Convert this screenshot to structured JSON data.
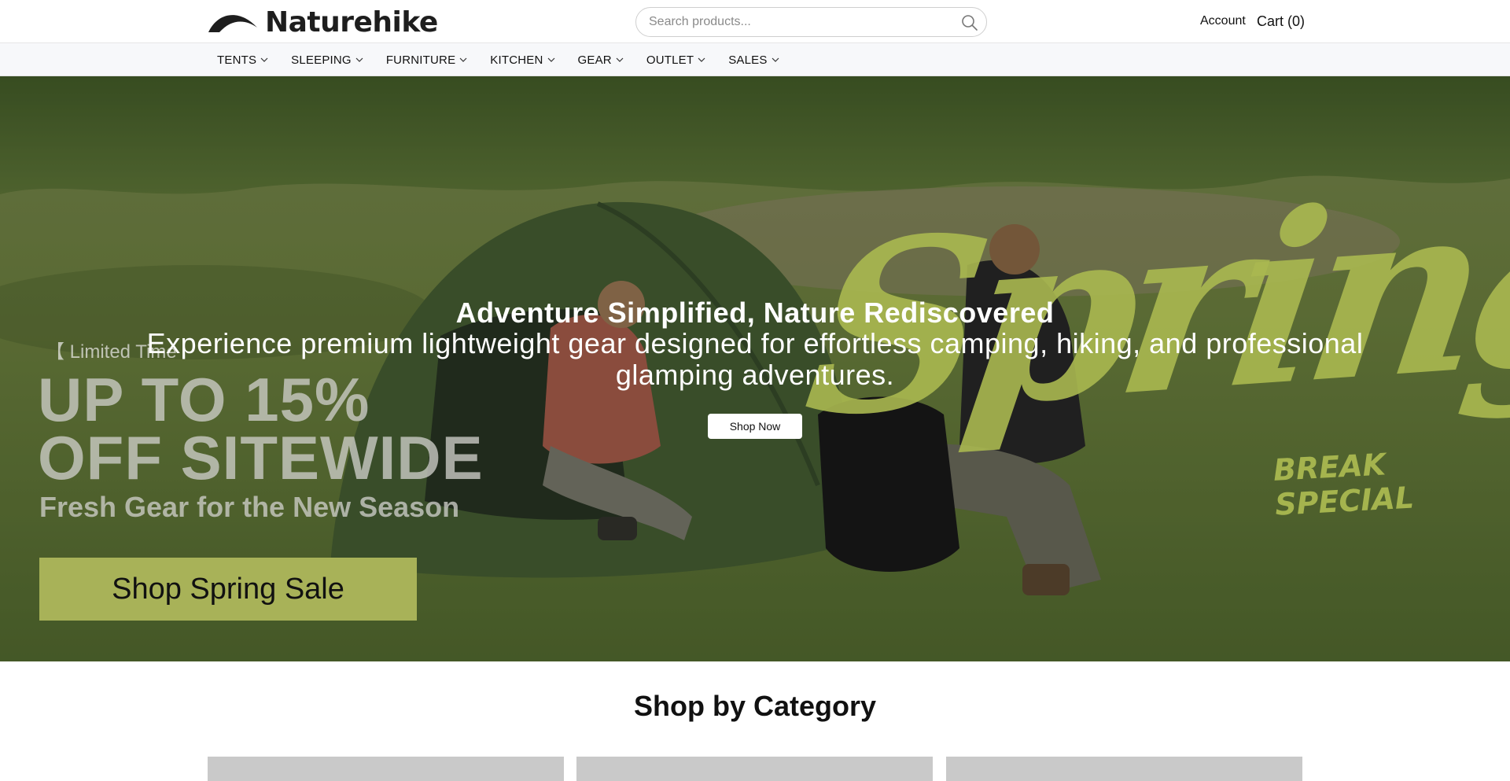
{
  "header": {
    "brand": "Naturehike",
    "search": {
      "placeholder": "Search products..."
    },
    "account_label": "Account",
    "cart_label": "Cart (0)"
  },
  "nav": {
    "items": [
      {
        "label": "TENTS"
      },
      {
        "label": "SLEEPING"
      },
      {
        "label": "FURNITURE"
      },
      {
        "label": "KITCHEN"
      },
      {
        "label": "GEAR"
      },
      {
        "label": "OUTLET"
      },
      {
        "label": "SALES"
      }
    ]
  },
  "hero": {
    "image_text": {
      "tag": "【 Limited Time",
      "headline": "UP TO 15% OFF SITEWIDE",
      "subline": "Fresh Gear for the New Season",
      "button": "Shop Spring Sale",
      "spring_word": "Spring",
      "spring_sub": "BREAK SPECIAL"
    },
    "title": "Adventure Simplified, Nature Rediscovered",
    "description": "Experience premium lightweight gear designed for effortless camping, hiking, and professional glamping adventures.",
    "cta": "Shop Now"
  },
  "categories": {
    "title": "Shop by Category"
  },
  "colors": {
    "accent_green": "#a8b258",
    "tent_green": "#4f6b3a",
    "grass": "#6f8a45"
  },
  "icons": [
    "logo-arc-icon",
    "search-icon",
    "chevron-down-icon"
  ]
}
